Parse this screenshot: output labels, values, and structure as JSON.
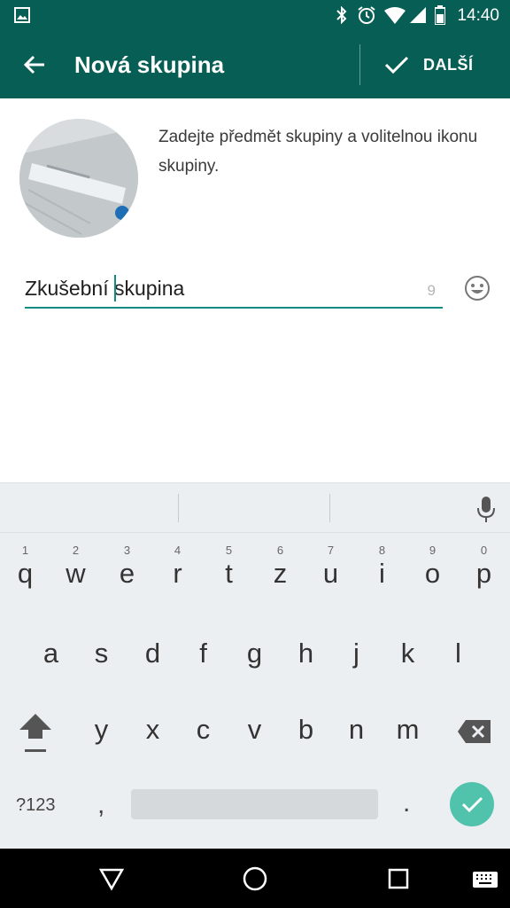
{
  "status_bar": {
    "time": "14:40"
  },
  "app_bar": {
    "title": "Nová skupina",
    "next_label": "DALŠÍ"
  },
  "content": {
    "description": "Zadejte předmět skupiny a volitelnou ikonu skupiny.",
    "group_name_value": "Zkušební skupina",
    "char_remaining": "9"
  },
  "keyboard": {
    "row1": [
      {
        "key": "q",
        "hint": "1"
      },
      {
        "key": "w",
        "hint": "2"
      },
      {
        "key": "e",
        "hint": "3"
      },
      {
        "key": "r",
        "hint": "4"
      },
      {
        "key": "t",
        "hint": "5"
      },
      {
        "key": "z",
        "hint": "6"
      },
      {
        "key": "u",
        "hint": "7"
      },
      {
        "key": "i",
        "hint": "8"
      },
      {
        "key": "o",
        "hint": "9"
      },
      {
        "key": "p",
        "hint": "0"
      }
    ],
    "row2": [
      "a",
      "s",
      "d",
      "f",
      "g",
      "h",
      "j",
      "k",
      "l"
    ],
    "row3": [
      "y",
      "x",
      "c",
      "v",
      "b",
      "n",
      "m"
    ],
    "symbols_label": "?123",
    "comma": ",",
    "period": "."
  },
  "colors": {
    "primary": "#075e54",
    "accent": "#128c7e",
    "enter": "#51c2ac"
  }
}
